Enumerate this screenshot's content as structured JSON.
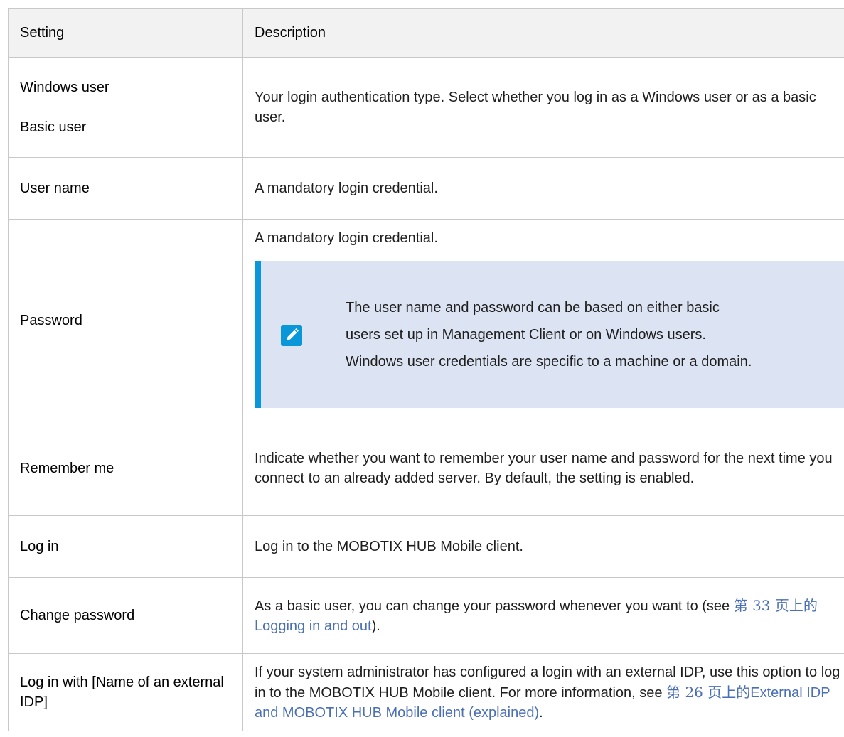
{
  "table": {
    "headers": {
      "setting": "Setting",
      "description": "Description"
    },
    "rows": [
      {
        "setting_lines": [
          "Windows user",
          "Basic user"
        ],
        "description": "Your login authentication type. Select whether you log in as a Windows user or as a basic user."
      },
      {
        "setting": "User name",
        "description": "A mandatory login credential."
      },
      {
        "setting": "Password",
        "description": "A mandatory login credential.",
        "note": {
          "icon": "pencil-icon",
          "text": "The user name and password can be based on either basic users set up in Management Client or on Windows users. Windows user credentials are specific to a machine or a domain."
        }
      },
      {
        "setting": "Remember me",
        "description": "Indicate whether you want to remember your user name and password for the next time you connect to an already added server. By default, the setting is enabled."
      },
      {
        "setting": "Log in",
        "description": "Log in to the MOBOTIX HUB Mobile client."
      },
      {
        "setting": "Change password",
        "description_before": "As a basic user, you can change your password whenever you want to (see ",
        "link_page": "第 33 页上的",
        "link_text": "Logging in and out",
        "description_after": ")."
      },
      {
        "setting": "Log in with [Name of an external IDP]",
        "description_before": "If your system administrator has configured a login with an external IDP, use this option to log in to the MOBOTIX HUB Mobile client. For more information, see ",
        "link_page": "第 26 页上的",
        "link_text": "External IDP and MOBOTIX HUB Mobile client (explained)",
        "description_after": "."
      }
    ]
  },
  "colors": {
    "link": "#4a6fb5",
    "note_bg": "#dce3f2",
    "note_accent": "#0a97d9",
    "header_bg": "#f2f2f2"
  }
}
